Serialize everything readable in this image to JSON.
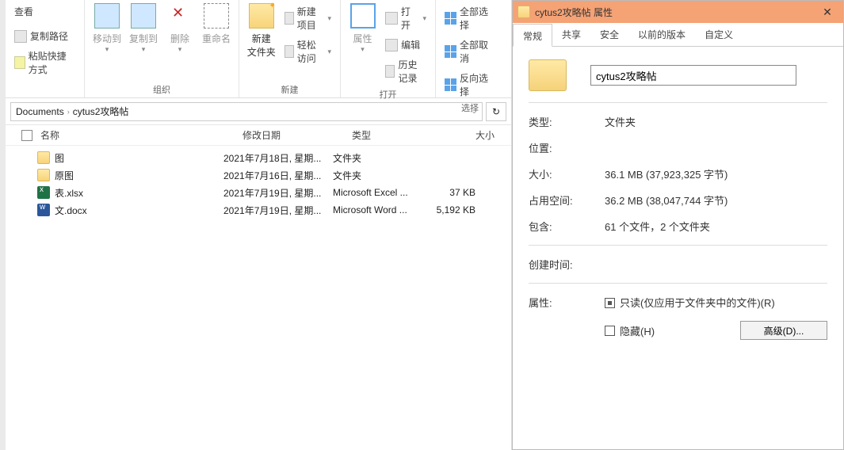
{
  "ribbon": {
    "view_btn": "查看",
    "clipboard": {
      "copy_path": "复制路径",
      "paste_shortcut": "粘贴快捷方式"
    },
    "organize": {
      "move_to": "移动到",
      "copy_to": "复制到",
      "delete": "删除",
      "rename": "重命名",
      "group": "组织"
    },
    "new": {
      "new_folder": "新建\n文件夹",
      "new_item": "新建项目",
      "easy_access": "轻松访问",
      "group": "新建"
    },
    "open": {
      "properties": "属性",
      "open": "打开",
      "edit": "编辑",
      "history": "历史记录",
      "group": "打开"
    },
    "select": {
      "select_all": "全部选择",
      "select_none": "全部取消",
      "invert": "反向选择",
      "group": "选择"
    }
  },
  "address": {
    "seg1": "Documents",
    "seg2": "cytus2攻略帖"
  },
  "columns": {
    "name": "名称",
    "date": "修改日期",
    "type": "类型",
    "size": "大小"
  },
  "files": [
    {
      "icon": "folder",
      "name": "图",
      "date": "2021年7月18日, 星期...",
      "type": "文件夹",
      "size": ""
    },
    {
      "icon": "folder",
      "name": "原图",
      "date": "2021年7月16日, 星期...",
      "type": "文件夹",
      "size": ""
    },
    {
      "icon": "xlsx",
      "name": "表.xlsx",
      "date": "2021年7月19日, 星期...",
      "type": "Microsoft Excel ...",
      "size": "37 KB"
    },
    {
      "icon": "docx",
      "name": "文.docx",
      "date": "2021年7月19日, 星期...",
      "type": "Microsoft Word ...",
      "size": "5,192 KB"
    }
  ],
  "props": {
    "title": "cytus2攻略帖 属性",
    "tabs": [
      "常规",
      "共享",
      "安全",
      "以前的版本",
      "自定义"
    ],
    "name": "cytus2攻略帖",
    "rows": {
      "type_l": "类型:",
      "type_v": "文件夹",
      "loc_l": "位置:",
      "loc_v": "",
      "size_l": "大小:",
      "size_v": "36.1 MB (37,923,325 字节)",
      "disk_l": "占用空间:",
      "disk_v": "36.2 MB (38,047,744 字节)",
      "cont_l": "包含:",
      "cont_v": "61 个文件，2 个文件夹",
      "ctime_l": "创建时间:",
      "ctime_v": "",
      "attr_l": "属性:",
      "readonly": "只读(仅应用于文件夹中的文件)(R)",
      "hidden": "隐藏(H)",
      "advanced": "高级(D)..."
    }
  }
}
